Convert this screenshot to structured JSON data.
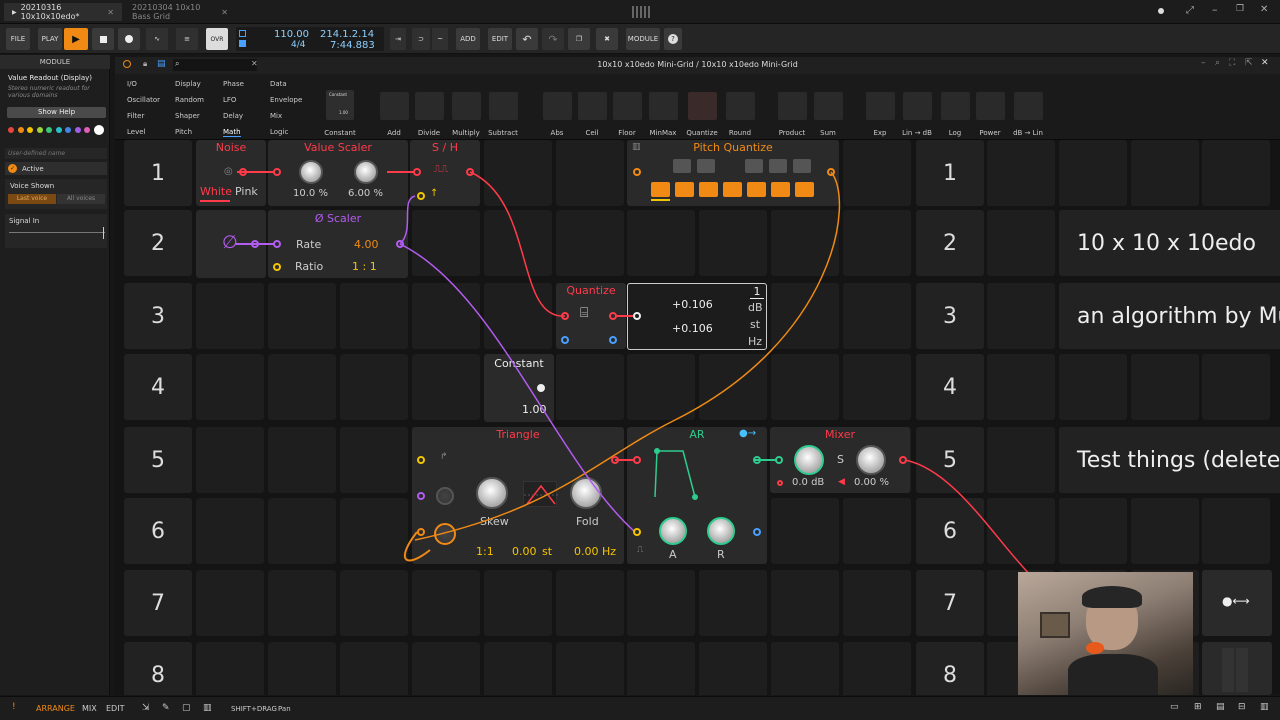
{
  "tabs": [
    {
      "label": "20210316 10x10x10edo*"
    },
    {
      "label": "20210304 10x10 Bass Grid"
    }
  ],
  "toolbar": {
    "file": "FILE",
    "play_mode": "PLAY",
    "tempo": "110.00",
    "signature": "4/4",
    "position": "214.1.2.14",
    "time": "7:44.883",
    "add": "ADD",
    "edit": "EDIT",
    "module": "MODULE"
  },
  "inspector": {
    "section": "MODULE",
    "title": "Value Readout (Display)",
    "description": "Stereo numeric readout for various domains",
    "help_button": "Show Help",
    "name_placeholder": "User-defined name",
    "active_label": "Active",
    "voice_shown_label": "Voice Shown",
    "voice_options": [
      "Last voice",
      "All voices"
    ],
    "signal_in_label": "Signal In",
    "swatches": [
      "#e8453c",
      "#f08a15",
      "#f5c400",
      "#9ed63a",
      "#3bc779",
      "#28c1c9",
      "#3f86e8",
      "#a45ee5",
      "#e25fb6",
      "#ffffff"
    ]
  },
  "editor": {
    "title": "10x10 x10edo Mini-Grid  /  10x10 x10edo Mini-Grid"
  },
  "browser": {
    "categories": [
      [
        "I/O",
        "Display",
        "Phase",
        "Data"
      ],
      [
        "Oscillator",
        "Random",
        "LFO",
        "Envelope"
      ],
      [
        "Filter",
        "Shaper",
        "Delay",
        "Mix"
      ],
      [
        "Level",
        "Pitch",
        "Math",
        "Logic"
      ]
    ],
    "selected_category": "Math",
    "constant_preview": [
      "Constant",
      "1.00"
    ],
    "modules": [
      "Constant",
      "Add",
      "Divide",
      "Multiply",
      "Subtract",
      "Abs",
      "Ceil",
      "Floor",
      "MinMax",
      "Quantize",
      "Round",
      "Product",
      "Sum",
      "Exp",
      "Lin → dB",
      "Log",
      "Power",
      "dB → Lin"
    ]
  },
  "grid": {
    "rows": [
      "1",
      "2",
      "3",
      "4",
      "5",
      "6",
      "7",
      "8"
    ],
    "noise": {
      "title": "Noise",
      "white": "White",
      "pink": "Pink"
    },
    "value_scaler": {
      "title": "Value Scaler",
      "v1": "10.0 %",
      "v2": "6.00 %"
    },
    "sh": {
      "title": "S / H"
    },
    "pitch_quantize": {
      "title": "Pitch Quantize"
    },
    "phase_scaler": {
      "title": "Ø Scaler",
      "rate_label": "Rate",
      "rate_value": "4.00",
      "ratio_label": "Ratio",
      "ratio_value": "1 : 1"
    },
    "quantize": {
      "title": "Quantize"
    },
    "readout": {
      "value1": "+0.106",
      "value2": "+0.106",
      "units": [
        "1",
        "dB",
        "st",
        "Hz"
      ]
    },
    "constant": {
      "title": "Constant",
      "value": "1.00"
    },
    "triangle": {
      "title": "Triangle",
      "skew": "Skew",
      "fold": "Fold",
      "ratio": "1:1",
      "pitch": "0.00",
      "pitch_unit": "st",
      "freq": "0.00 Hz"
    },
    "ar": {
      "title": "AR",
      "a": "A",
      "r": "R"
    },
    "mixer": {
      "title": "Mixer",
      "s": "S",
      "v1": "0.0 dB",
      "v2": "0.00 %"
    },
    "notes": [
      "10 x 10 x 10edo",
      "an algorithm by Mu",
      "Test things (delete"
    ]
  },
  "status": {
    "arrange": "ARRANGE",
    "mix": "MIX",
    "edit": "EDIT",
    "hint_key": "SHIFT+DRAG",
    "hint_action": "Pan"
  }
}
